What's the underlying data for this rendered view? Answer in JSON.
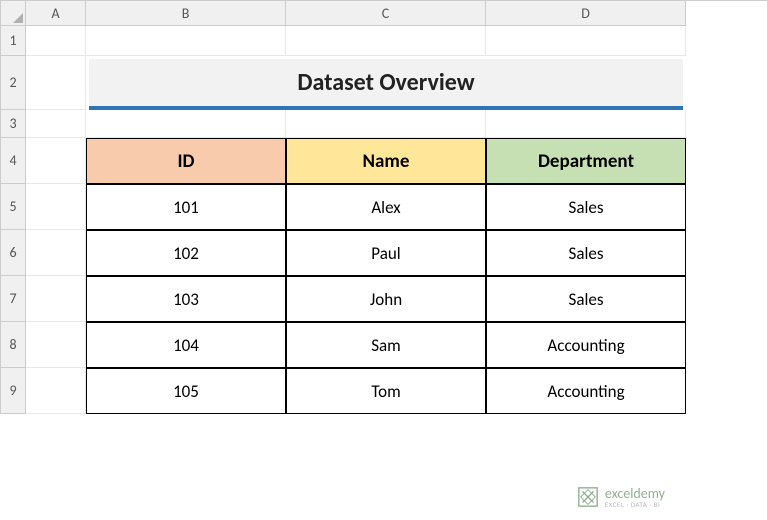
{
  "columns": [
    "A",
    "B",
    "C",
    "D"
  ],
  "rows": [
    "1",
    "2",
    "3",
    "4",
    "5",
    "6",
    "7",
    "8",
    "9"
  ],
  "title": "Dataset Overview",
  "headers": {
    "id": "ID",
    "name": "Name",
    "department": "Department"
  },
  "data": [
    {
      "id": "101",
      "name": "Alex",
      "dept": "Sales"
    },
    {
      "id": "102",
      "name": "Paul",
      "dept": "Sales"
    },
    {
      "id": "103",
      "name": "John",
      "dept": "Sales"
    },
    {
      "id": "104",
      "name": "Sam",
      "dept": "Accounting"
    },
    {
      "id": "105",
      "name": "Tom",
      "dept": "Accounting"
    }
  ],
  "watermark": {
    "main": "exceldemy",
    "sub": "EXCEL · DATA · BI"
  },
  "chart_data": {
    "type": "table",
    "title": "Dataset Overview",
    "columns": [
      "ID",
      "Name",
      "Department"
    ],
    "rows": [
      [
        "101",
        "Alex",
        "Sales"
      ],
      [
        "102",
        "Paul",
        "Sales"
      ],
      [
        "103",
        "John",
        "Sales"
      ],
      [
        "104",
        "Sam",
        "Accounting"
      ],
      [
        "105",
        "Tom",
        "Accounting"
      ]
    ]
  }
}
